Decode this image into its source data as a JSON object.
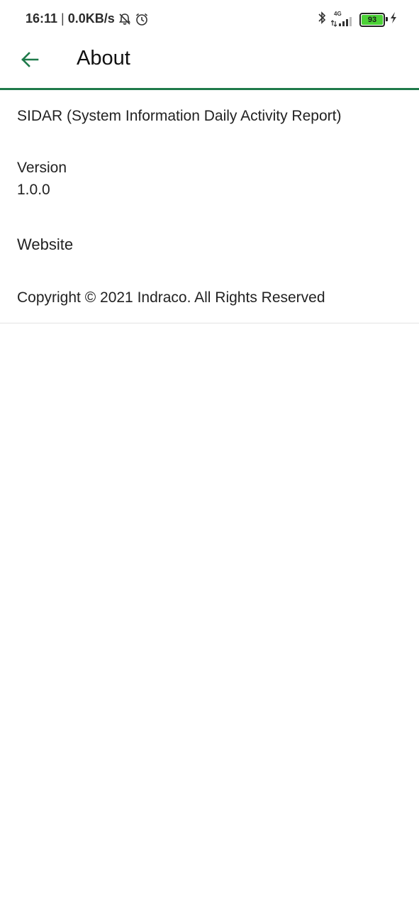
{
  "status_bar": {
    "time": "16:11",
    "separator": "|",
    "network_speed": "0.0KB/s",
    "network_type": "4G",
    "battery_level": "93",
    "battery_color": "#4cd137",
    "icons": [
      "muted-bell-icon",
      "alarm-icon",
      "bluetooth-icon",
      "signal-icon",
      "battery-icon",
      "charging-icon"
    ]
  },
  "app_bar": {
    "title": "About",
    "accent_color": "#1f7a4a",
    "back_icon": "arrow-left-icon"
  },
  "about": {
    "app_name": "SIDAR (System Information Daily Activity Report)",
    "version_label": "Version",
    "version_value": "1.0.0",
    "website_label": "Website",
    "copyright": "Copyright © 2021 Indraco. All Rights Reserved"
  }
}
